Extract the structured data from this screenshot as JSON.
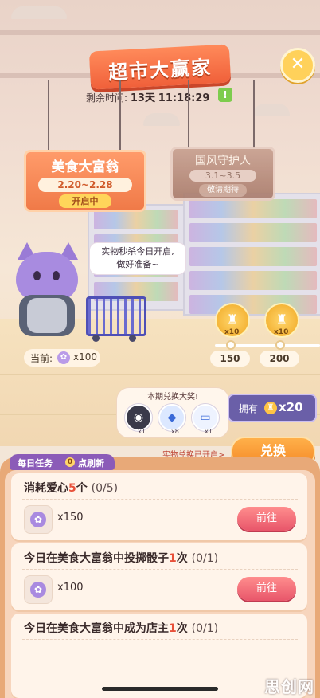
{
  "header": {
    "title": "超市大赢家",
    "countdown_label": "剩余时间:",
    "countdown_days": "13天",
    "countdown_time": "11:18:29",
    "countdown_badge": "!",
    "close_symbol": "✕"
  },
  "signs": [
    {
      "name": "美食大富翁",
      "dates": "2.20~2.28",
      "status": "开启中"
    },
    {
      "name": "国风守护人",
      "dates": "3.1~3.5",
      "status": "敬请期待"
    }
  ],
  "mascot": {
    "speech": [
      "实物秒杀今日开启,",
      "做好准备~"
    ],
    "current_label": "当前:",
    "current_amount": "x100"
  },
  "milestones": [
    {
      "coin_qty": "x10",
      "value": "150"
    },
    {
      "coin_qty": "x10",
      "value": "200"
    }
  ],
  "prize": {
    "title": "本期兑换大奖!",
    "items": [
      {
        "icon": "robot-vacuum-icon",
        "qty": "x1"
      },
      {
        "icon": "diamond-icon",
        "qty": "x8"
      },
      {
        "icon": "bank-card-icon",
        "qty": "x1"
      }
    ],
    "owned_label": "拥有",
    "owned_count": "x20",
    "note": "实物兑换已开启>",
    "redeem_label": "兑换"
  },
  "tasks": {
    "tab_label": "每日任务",
    "tab_count": "0",
    "tab_suffix": "点刷新",
    "items": [
      {
        "pre": "消耗爱心",
        "hl": "5",
        "post": "个",
        "progress": "(0/5)",
        "reward": "x150",
        "button": "前往"
      },
      {
        "pre": "今日在美食大富翁中投掷骰子",
        "hl": "1",
        "post": "次",
        "progress": "(0/1)",
        "reward": "x100",
        "button": "前往"
      },
      {
        "pre": "今日在美食大富翁中成为店主",
        "hl": "1",
        "post": "次",
        "progress": "(0/1)"
      }
    ]
  },
  "watermark": "思创网",
  "colors": {
    "accent_orange": "#f0603a",
    "task_tab_purple": "#8b5bb8",
    "go_button_pink": "#e8566a",
    "highlight_red": "#e8503a"
  }
}
